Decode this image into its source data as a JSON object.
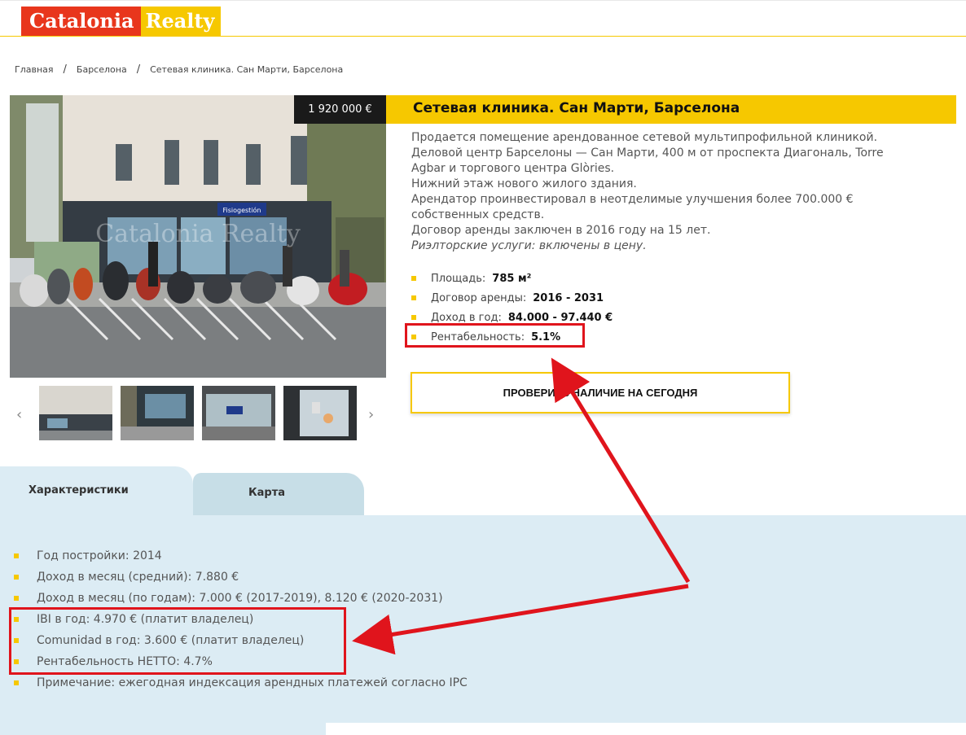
{
  "header": {
    "logo_part1": "Catalonia",
    "logo_part2": "Realty"
  },
  "breadcrumb": {
    "items": [
      "Главная",
      "Барселона",
      "Сетевая клиника. Сан Марти, Барселона"
    ],
    "separator": "/"
  },
  "listing": {
    "price": "1 920 000 €",
    "title": "Сетевая клиника. Сан Марти, Барселона",
    "description": [
      "Продается помещение арендованное сетевой мультипрофильной клиникой.",
      "Деловой центр Барселоны — Сан Марти, 400 м от проспекта Диагональ, Torre",
      "Agbar и торгового центра Glòries.",
      "Нижний этаж нового жилого здания.",
      "Арендатор проинвестировал в неотделимые улучшения более 700.000 €",
      "собственных средств.",
      "Договор аренды заключен в 2016 году на 15 лет."
    ],
    "description_italic": "Риэлторские услуги: включены в цену.",
    "facts": [
      {
        "label": "Площадь:",
        "value": "785 м²"
      },
      {
        "label": "Договор аренды:",
        "value": "2016 - 2031"
      },
      {
        "label": "Доход в год:",
        "value": "84.000 - 97.440 €"
      },
      {
        "label": "Рентабельность:",
        "value": "5.1%"
      }
    ],
    "check_button": "ПРОВЕРИТЬ НАЛИЧИЕ НА СЕГОДНЯ",
    "photo_watermark": "Catalonia Realty",
    "photo_sign": "Fisiogestión"
  },
  "gallery": {
    "prev": "‹",
    "next": "›"
  },
  "tabs": [
    {
      "label": "Характеристики",
      "active": true
    },
    {
      "label": "Карта",
      "active": false
    }
  ],
  "characteristics": [
    "Год постройки: 2014",
    "Доход в месяц (средний): 7.880 €",
    "Доход в месяц (по годам): 7.000 € (2017-2019), 8.120 € (2020-2031)",
    "IBI в год: 4.970 € (платит владелец)",
    "Comunidad в год: 3.600 € (платит владелец)",
    "Рентабельность НЕТТО: 4.7%",
    "Примечание: ежегодная индексация арендных платежей согласно IPC"
  ],
  "colors": {
    "brand_red": "#e8361c",
    "brand_yellow": "#f6c800",
    "annotation_red": "#e0141c",
    "panel": "#dcecf4"
  }
}
